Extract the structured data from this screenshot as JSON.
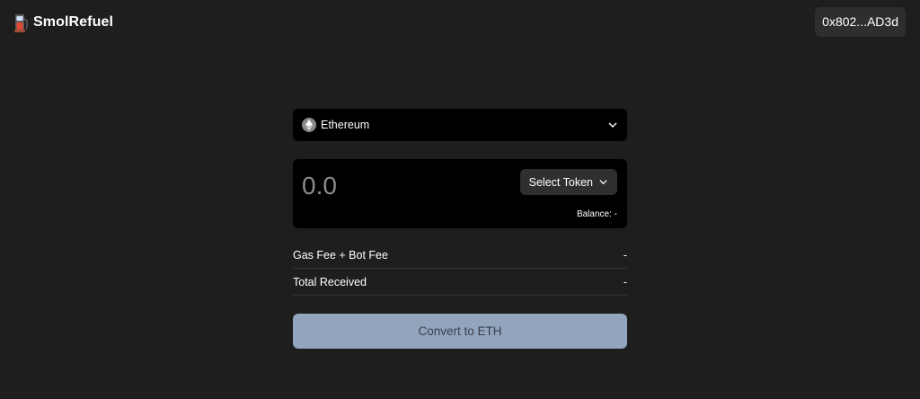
{
  "app": {
    "name": "SmolRefuel",
    "logo_icon": "fuel-pump-icon"
  },
  "wallet": {
    "address": "0x802...AD3d"
  },
  "chain_select": {
    "selected": "Ethereum",
    "icon": "ethereum-icon"
  },
  "amount": {
    "placeholder": "0.0",
    "value": ""
  },
  "token_select": {
    "label": "Select Token",
    "icon": "chevron-down-icon"
  },
  "balance": {
    "label": "Balance:",
    "value": "-"
  },
  "fees": [
    {
      "label": "Gas Fee + Bot Fee",
      "value": "-"
    },
    {
      "label": "Total Received",
      "value": "-"
    }
  ],
  "convert_button": {
    "label": "Convert to ETH"
  },
  "colors": {
    "background": "#1f1e1f",
    "panel": "#000000",
    "button_disabled": "#93a4bd",
    "wallet_chip": "#2e2d2f"
  }
}
